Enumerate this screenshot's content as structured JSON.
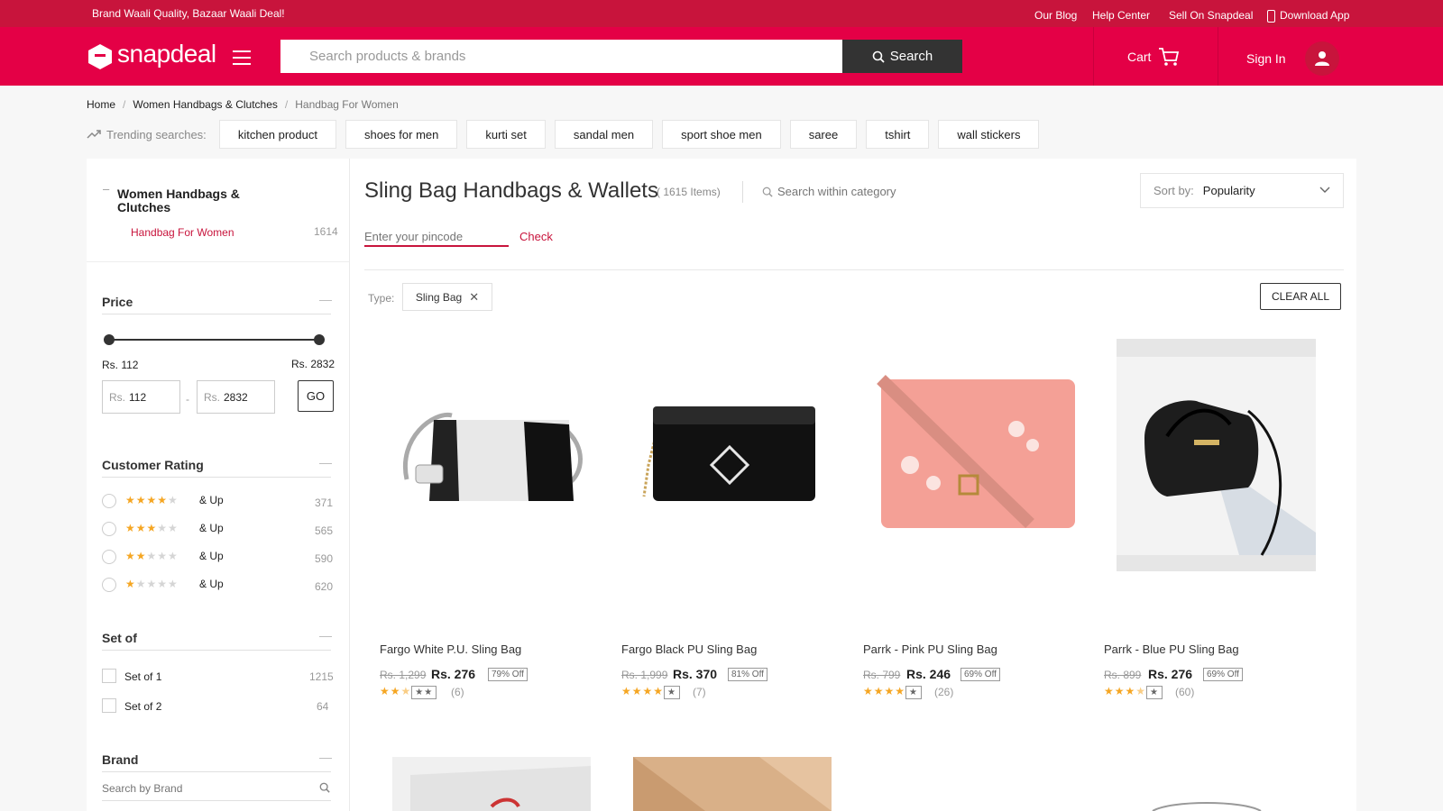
{
  "top_strip": {
    "tagline": "Brand Waali Quality, Bazaar Waali Deal!",
    "links": [
      "Our Blog",
      "Help Center",
      "Sell On Snapdeal",
      "Download App"
    ]
  },
  "header": {
    "logo_text": "snapdeal",
    "search_placeholder": "Search products & brands",
    "search_button": "Search",
    "cart_label": "Cart",
    "signin_label": "Sign In"
  },
  "breadcrumb": [
    "Home",
    "Women Handbags & Clutches",
    "Handbag For Women"
  ],
  "breadcrumb_sep": "/",
  "trending": {
    "label": "Trending searches:",
    "items": [
      "kitchen product",
      "shoes for men",
      "kurti set",
      "sandal men",
      "sport shoe men",
      "saree",
      "tshirt",
      "wall stickers"
    ]
  },
  "sidebar": {
    "category": {
      "title": "Women Handbags & Clutches",
      "sub": "Handbag For Women",
      "sub_count": "1614"
    },
    "price": {
      "title": "Price",
      "min_label": "Rs. 112",
      "max_label": "Rs. 2832",
      "rs": "Rs.",
      "min_value": "112",
      "max_value": "2832",
      "go": "GO",
      "range_sep": "-"
    },
    "rating": {
      "title": "Customer Rating",
      "suffix": "& Up",
      "options": [
        {
          "stars": 4,
          "count": "371"
        },
        {
          "stars": 3,
          "count": "565"
        },
        {
          "stars": 2,
          "count": "590"
        },
        {
          "stars": 1,
          "count": "620"
        }
      ]
    },
    "setof": {
      "title": "Set of",
      "options": [
        {
          "label": "Set of 1",
          "count": "1215"
        },
        {
          "label": "Set of 2",
          "count": "64"
        }
      ]
    },
    "brand": {
      "title": "Brand",
      "placeholder": "Search by Brand"
    }
  },
  "main": {
    "title": "Sling Bag Handbags & Wallets",
    "item_count": "( 1615 Items)",
    "search_within_placeholder": "Search within category",
    "sort_label": "Sort by:",
    "sort_value": "Popularity",
    "pincode_placeholder": "Enter your pincode",
    "check_label": "Check",
    "filter_type_label": "Type:",
    "filter_chip": "Sling Bag",
    "clear_all": "CLEAR ALL"
  },
  "products": [
    {
      "title": "Fargo White P.U. Sling Bag",
      "old_price": "Rs. 1,299",
      "price": "Rs. 276",
      "discount": "79% Off",
      "rating": 2.5,
      "reviews": "(6)"
    },
    {
      "title": "Fargo Black PU Sling Bag",
      "old_price": "Rs. 1,999",
      "price": "Rs. 370",
      "discount": "81% Off",
      "rating": 4,
      "reviews": "(7)"
    },
    {
      "title": "Parrk - Pink PU Sling Bag",
      "old_price": "Rs. 799",
      "price": "Rs. 246",
      "discount": "69% Off",
      "rating": 4,
      "reviews": "(26)"
    },
    {
      "title": "Parrk - Blue PU Sling Bag",
      "old_price": "Rs. 899",
      "price": "Rs. 276",
      "discount": "69% Off",
      "rating": 3.5,
      "reviews": "(60)"
    }
  ],
  "colors": {
    "brand": "#e40046",
    "brand_dark": "#c8143c",
    "accent_text": "#c8143c",
    "star": "#f5a623"
  },
  "icons": [
    "snapdeal-logo-icon",
    "hamburger-icon",
    "search-icon",
    "cart-icon",
    "user-icon",
    "mobile-icon",
    "trending-icon",
    "chevron-down-icon",
    "close-icon"
  ]
}
